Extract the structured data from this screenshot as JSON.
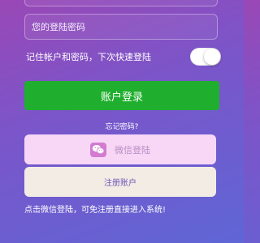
{
  "form": {
    "password_placeholder": "您的登陆密码",
    "remember_label": "记住帐户和密码，下次快速登陆",
    "remember_enabled": false
  },
  "buttons": {
    "login_label": "账户登录",
    "forgot_label": "忘记密码?",
    "wechat_label": "微信登陆",
    "register_label": "注册账户"
  },
  "icons": {
    "wechat": "wechat-icon"
  },
  "hint_text": "点击微信登陆，可免注册直接进入系统!",
  "colors": {
    "login_button": "#1fae2d",
    "wechat_button": "#f7d6f6",
    "register_button": "#f2ece4"
  }
}
